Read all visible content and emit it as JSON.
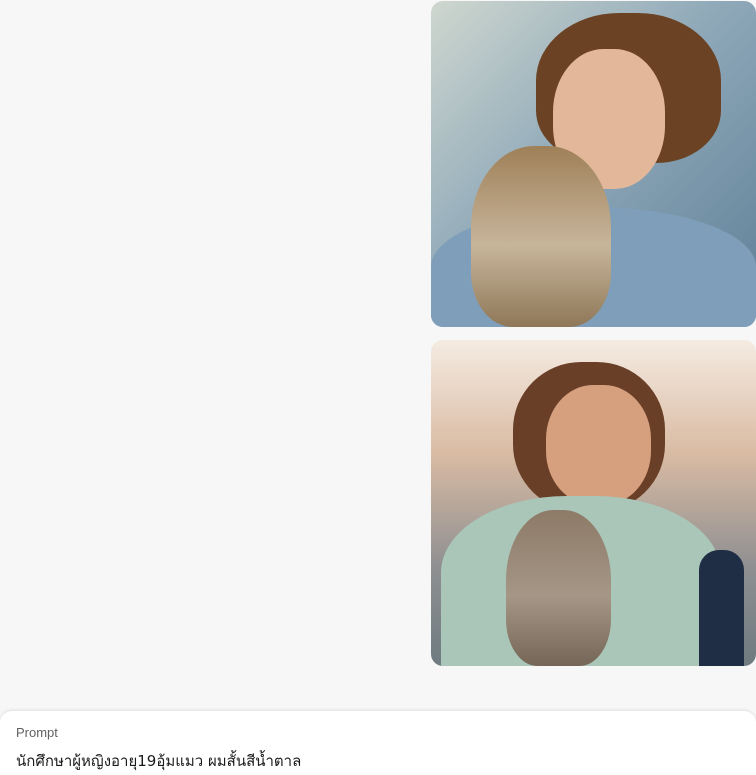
{
  "prompt": {
    "label": "Prompt",
    "text": "นักศึกษาผู้หญิงอายุ19อุ้มแมว ผมสั้นสีน้ำตาล"
  },
  "images": [
    {
      "subject": "young-woman-with-cat-image"
    },
    {
      "subject": "young-woman-with-cat-image"
    }
  ]
}
